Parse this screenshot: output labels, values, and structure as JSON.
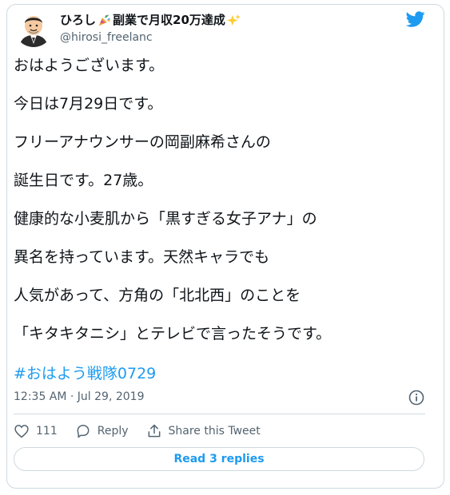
{
  "tweet": {
    "display_name": "ひろし",
    "display_name_suffix": "副業で月収20万達成",
    "handle": "@hirosi_freelanc",
    "lines": [
      "おはようございます。",
      "今日は7月29日です。",
      "フリーアナウンサーの岡副麻希さんの",
      "誕生日です。27歳。",
      "健康的な小麦肌から「黒すぎる女子アナ」の",
      "異名を持っています。天然キャラでも",
      "人気があって、方角の「北北西」のことを",
      "「キタキタニシ」とテレビで言ったそうです。"
    ],
    "hashtag": "#おはよう戦隊0729",
    "timestamp": "12:35 AM · Jul 29, 2019"
  },
  "actions": {
    "like_count": "111",
    "reply_label": "Reply",
    "share_label": "Share this Tweet"
  },
  "read_replies_label": "Read 3 replies",
  "icons": {
    "avatar": "avatar-man-icon",
    "party": "party-popper-icon",
    "sparkles": "sparkles-icon",
    "bird": "twitter-bird-icon",
    "info": "info-icon",
    "heart": "heart-icon",
    "reply": "reply-bubble-icon",
    "share": "share-icon"
  },
  "colors": {
    "accent": "#1d9bf0",
    "muted": "#536471",
    "border": "#cfd9de"
  }
}
